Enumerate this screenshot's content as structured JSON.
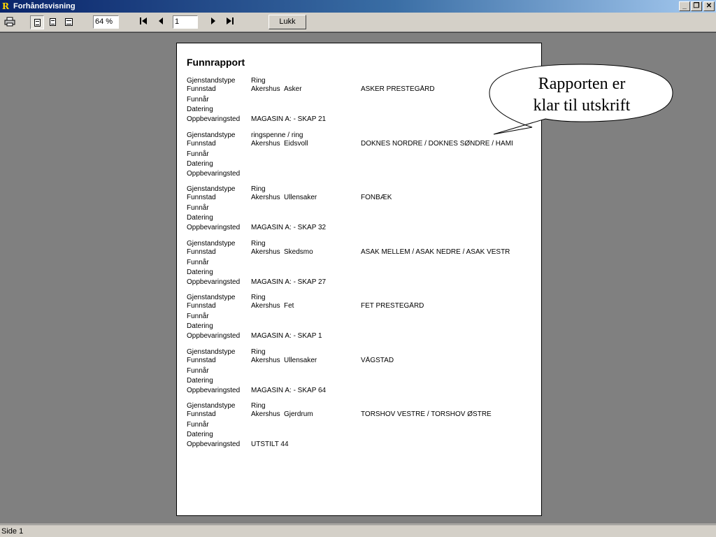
{
  "window": {
    "title": "Forhåndsvisning",
    "app_icon": "R",
    "controls": {
      "minimize": "_",
      "maximize": "❐",
      "close": "✕"
    }
  },
  "toolbar": {
    "zoom": "64 %",
    "page_number": "1",
    "close_label": "Lukk",
    "icons": [
      "printer-icon",
      "one-page-icon",
      "two-page-icon",
      "multi-page-icon",
      "first-page-icon",
      "prev-page-icon",
      "next-page-icon",
      "last-page-icon"
    ]
  },
  "report": {
    "title": "Funnrapport",
    "labels": {
      "type": "Gjenstandstype",
      "site": "Funnstad",
      "year": "Funnår",
      "dating": "Datering",
      "storage": "Oppbevaringsted"
    },
    "records": [
      {
        "type": "Ring",
        "county": "Akershus",
        "municipality": "Asker",
        "farm": "ASKER PRESTEGÅRD",
        "year": "",
        "dating": "",
        "storage": "MAGASIN A: - SKAP 21"
      },
      {
        "type": "ringspenne / ring",
        "county": "Akershus",
        "municipality": "Eidsvoll",
        "farm": "DOKNES NORDRE / DOKNES SØNDRE / HAMI",
        "year": "",
        "dating": "",
        "storage": ""
      },
      {
        "type": "Ring",
        "county": "Akershus",
        "municipality": "Ullensaker",
        "farm": "FONBÆK",
        "year": "",
        "dating": "",
        "storage": "MAGASIN A: - SKAP 32"
      },
      {
        "type": "Ring",
        "county": "Akershus",
        "municipality": "Skedsmo",
        "farm": "ASAK MELLEM / ASAK NEDRE / ASAK VESTR",
        "year": "",
        "dating": "",
        "storage": "MAGASIN A: - SKAP 27"
      },
      {
        "type": "Ring",
        "county": "Akershus",
        "municipality": "Fet",
        "farm": "FET PRESTEGÅRD",
        "year": "",
        "dating": "",
        "storage": "MAGASIN A: - SKAP 1"
      },
      {
        "type": "Ring",
        "county": "Akershus",
        "municipality": "Ullensaker",
        "farm": "VÅGSTAD",
        "year": "",
        "dating": "",
        "storage": "MAGASIN A: - SKAP 64"
      },
      {
        "type": "Ring",
        "county": "Akershus",
        "municipality": "Gjerdrum",
        "farm": "TORSHOV VESTRE / TORSHOV ØSTRE",
        "year": "",
        "dating": "",
        "storage": "UTSTILT 44"
      }
    ]
  },
  "callout": {
    "line1": "Rapporten er",
    "line2": "klar til utskrift"
  },
  "status": {
    "text": "Side 1"
  }
}
